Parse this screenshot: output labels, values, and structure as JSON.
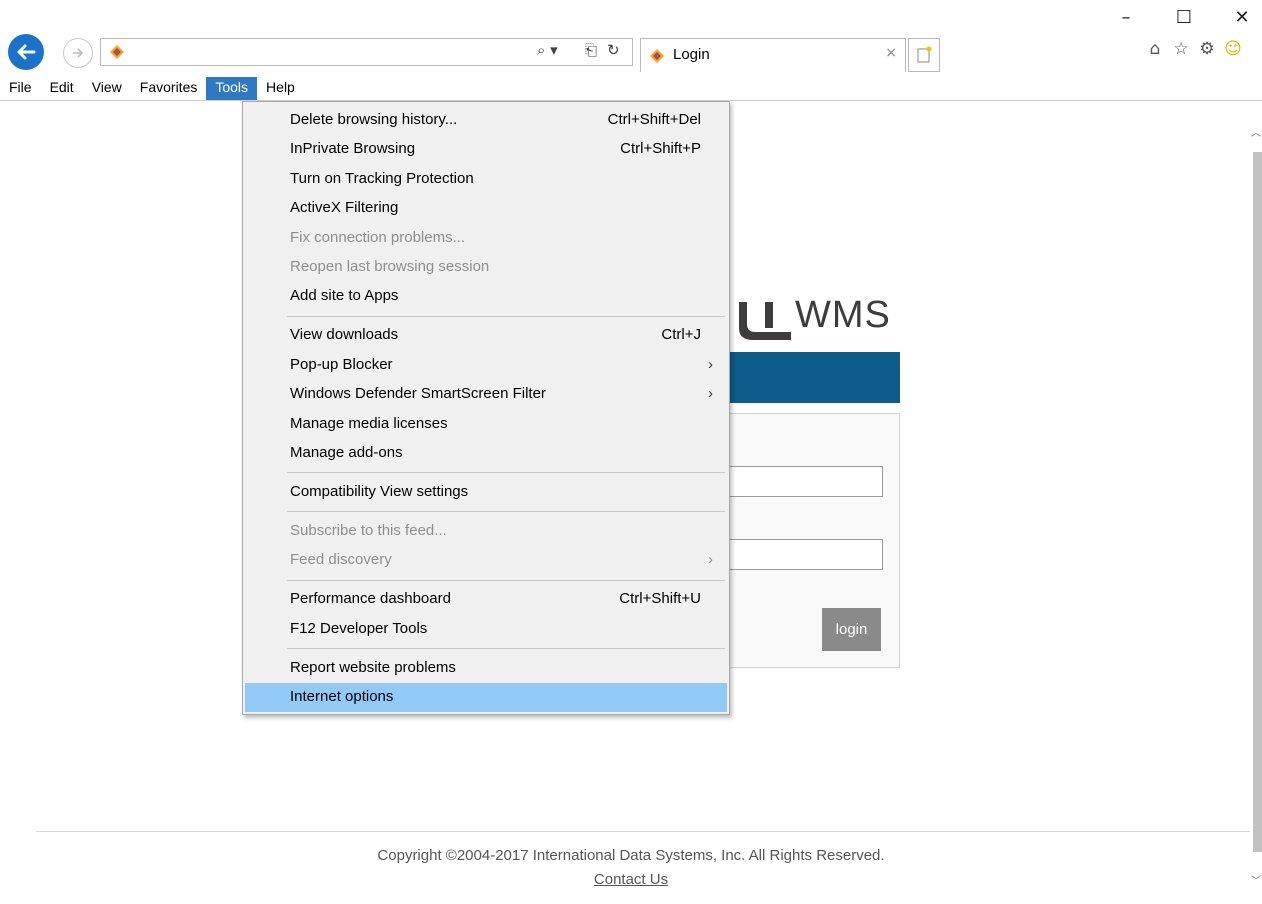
{
  "window": {
    "minimize_glyph": "–",
    "maximize_glyph": "☐",
    "close_glyph": "✕"
  },
  "address_bar": {
    "url": "",
    "search_glyph": "⌕ ▾",
    "compat_glyph": "⎗",
    "refresh_glyph": "↻"
  },
  "tab": {
    "title": "Login",
    "close_glyph": "×"
  },
  "toolbar_icons": [
    {
      "name": "home-icon",
      "glyph": "⌂"
    },
    {
      "name": "favorites-icon",
      "glyph": "☆"
    },
    {
      "name": "tools-gear-icon",
      "glyph": "⚙"
    },
    {
      "name": "feedback-smiley-icon",
      "glyph": "☺"
    }
  ],
  "menubar": {
    "items": [
      "File",
      "Edit",
      "View",
      "Favorites",
      "Tools",
      "Help"
    ],
    "active": "Tools"
  },
  "tools_menu": {
    "groups": [
      [
        {
          "label": "Delete browsing history...",
          "shortcut": "Ctrl+Shift+Del",
          "disabled": false
        },
        {
          "label": "InPrivate Browsing",
          "shortcut": "Ctrl+Shift+P",
          "disabled": false
        },
        {
          "label": "Turn on Tracking Protection",
          "shortcut": "",
          "disabled": false
        },
        {
          "label": "ActiveX Filtering",
          "shortcut": "",
          "disabled": false
        },
        {
          "label": "Fix connection problems...",
          "shortcut": "",
          "disabled": true
        },
        {
          "label": "Reopen last browsing session",
          "shortcut": "",
          "disabled": true
        },
        {
          "label": "Add site to Apps",
          "shortcut": "",
          "disabled": false
        }
      ],
      [
        {
          "label": "View downloads",
          "shortcut": "Ctrl+J",
          "disabled": false
        },
        {
          "label": "Pop-up Blocker",
          "shortcut": "",
          "submenu": true,
          "disabled": false
        },
        {
          "label": "Windows Defender SmartScreen Filter",
          "shortcut": "",
          "submenu": true,
          "disabled": false
        },
        {
          "label": "Manage media licenses",
          "shortcut": "",
          "disabled": false
        },
        {
          "label": "Manage add-ons",
          "shortcut": "",
          "disabled": false
        }
      ],
      [
        {
          "label": "Compatibility View settings",
          "shortcut": "",
          "disabled": false
        }
      ],
      [
        {
          "label": "Subscribe to this feed...",
          "shortcut": "",
          "disabled": true
        },
        {
          "label": "Feed discovery",
          "shortcut": "",
          "submenu": true,
          "disabled": true
        }
      ],
      [
        {
          "label": "Performance dashboard",
          "shortcut": "Ctrl+Shift+U",
          "disabled": false
        },
        {
          "label": "F12 Developer Tools",
          "shortcut": "",
          "disabled": false
        }
      ],
      [
        {
          "label": "Report website problems",
          "shortcut": "",
          "disabled": false
        },
        {
          "label": "Internet options",
          "shortcut": "",
          "disabled": false,
          "highlighted": true
        }
      ]
    ]
  },
  "page": {
    "logo_text": "WMS",
    "login_button": "login",
    "copyright": "Copyright ©2004-2017 International Data Systems, Inc. All Rights Reserved.",
    "contact_link": "Contact Us"
  },
  "colors": {
    "accent_blue": "#0e5c8b",
    "menu_highlight": "#91c9f7",
    "menubar_active": "#2f78c4"
  }
}
